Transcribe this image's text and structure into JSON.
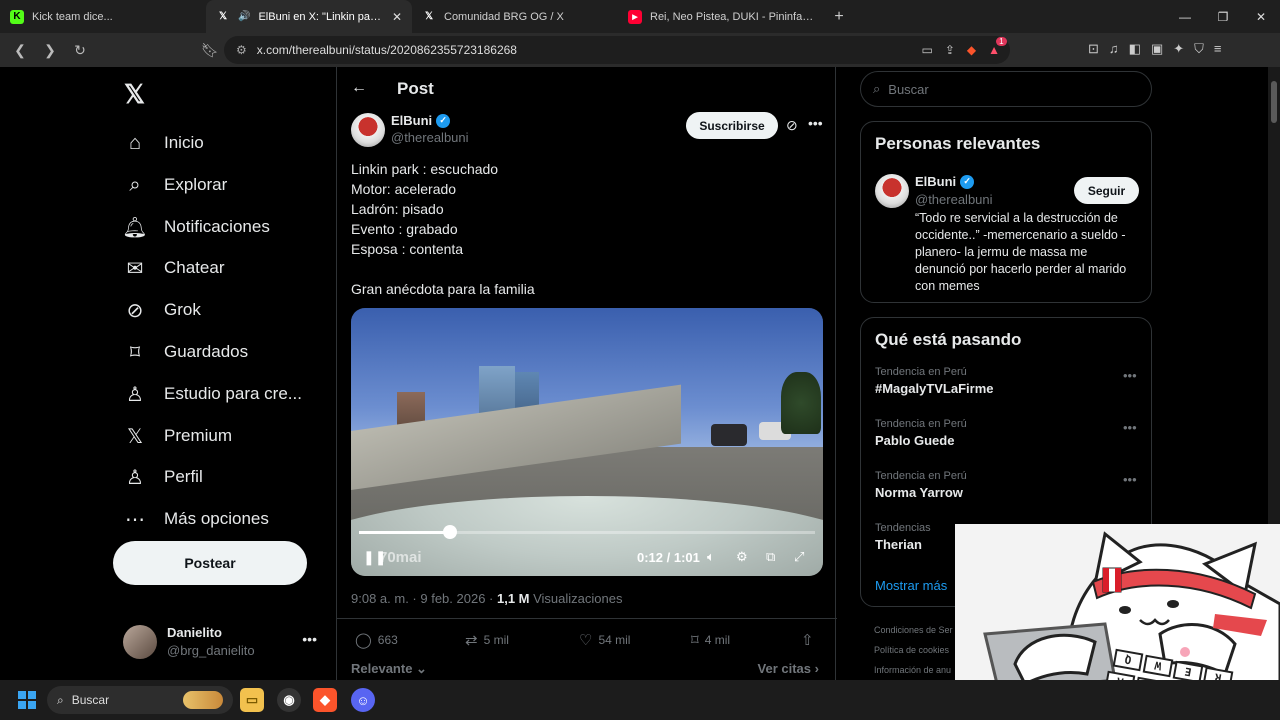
{
  "browser": {
    "tabs": [
      {
        "title": "Kick team dice...",
        "favicon": "kick-icon",
        "active": false,
        "color": "#53fc18"
      },
      {
        "title": "ElBuni en X: \"Linkin park : esc",
        "favicon": "x-icon",
        "active": true
      },
      {
        "title": "Comunidad BRG OG / X",
        "favicon": "x-icon",
        "active": false
      },
      {
        "title": "Rei, Neo Pistea, DUKI - Pininfarina (R",
        "favicon": "youtube-icon",
        "active": false
      }
    ],
    "url": "x.com/therealbuni/status/2020862355723186268",
    "brave_badge": "1"
  },
  "nav": {
    "items": [
      {
        "label": "Inicio",
        "icon": "home-icon"
      },
      {
        "label": "Explorar",
        "icon": "search-icon"
      },
      {
        "label": "Notificaciones",
        "icon": "bell-icon"
      },
      {
        "label": "Chatear",
        "icon": "mail-icon"
      },
      {
        "label": "Grok",
        "icon": "grok-icon"
      },
      {
        "label": "Guardados",
        "icon": "bookmark-icon"
      },
      {
        "label": "Estudio para cre...",
        "icon": "studio-icon"
      },
      {
        "label": "Premium",
        "icon": "x-icon"
      },
      {
        "label": "Perfil",
        "icon": "user-icon"
      },
      {
        "label": "Más opciones",
        "icon": "more-circle-icon"
      }
    ],
    "post_button": "Postear",
    "account": {
      "name": "Danielito",
      "handle": "@brg_danielito"
    }
  },
  "post": {
    "header": "Post",
    "author": {
      "name": "ElBuni",
      "handle": "@therealbuni"
    },
    "subscribe": "Suscribirse",
    "lines": [
      "Linkin park : escuchado",
      "Motor: acelerado",
      "Ladrón: pisado",
      "Evento : grabado",
      "Esposa : contenta",
      "",
      "Gran anécdota para la familia"
    ],
    "video": {
      "time": "0:12 / 1:01",
      "progress": 0.2,
      "watermark": "70mai"
    },
    "timestamp": "9:08 a. m. · 9 feb. 2026 · ",
    "views_count": "1,1 M",
    "views_label": " Visualizaciones",
    "actions": {
      "replies": "663",
      "reposts": "5 mil",
      "likes": "54 mil",
      "bookmarks": "4 mil"
    },
    "sort": "Relevante",
    "quotes": "Ver citas"
  },
  "sidebar": {
    "search_placeholder": "Buscar",
    "relevant_title": "Personas relevantes",
    "person": {
      "name": "ElBuni",
      "handle": "@therealbuni",
      "follow": "Seguir",
      "bio": "“Todo re servicial a la destrucción de occidente..” -memercenario a sueldo -planero- la jermu de massa me denunció por hacerlo perder al marido con memes"
    },
    "trending_title": "Qué está pasando",
    "trends": [
      {
        "context": "Tendencia en Perú",
        "name": "#MagalyTVLaFirme"
      },
      {
        "context": "Tendencia en Perú",
        "name": "Pablo Guede"
      },
      {
        "context": "Tendencia en Perú",
        "name": "Norma Yarrow"
      },
      {
        "context": "Tendencias",
        "name": "Therian"
      }
    ],
    "show_more": "Mostrar más",
    "footer": [
      "Condiciones de Ser",
      "Política de cookies",
      "Información de anu"
    ]
  },
  "overlay": {
    "keyboard_keys": [
      "Q",
      "W",
      "E",
      "R",
      "A",
      "S",
      "D",
      "F"
    ]
  },
  "taskbar": {
    "search": "Buscar"
  },
  "colors": {
    "accent": "#1d9bf0",
    "background": "#000000",
    "border": "#2f3336",
    "muted": "#71767b"
  }
}
